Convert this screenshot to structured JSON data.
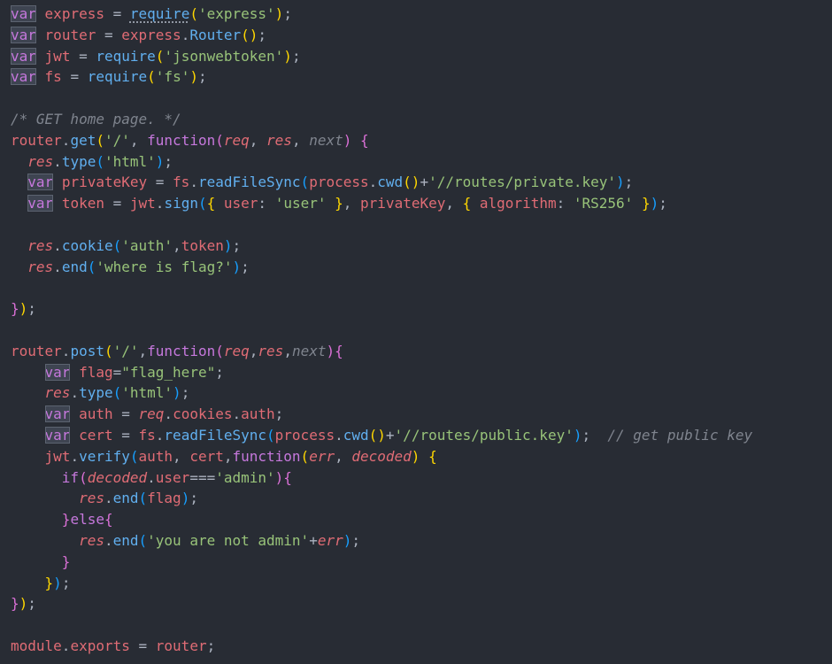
{
  "theme": {
    "background": "#282c34",
    "keyword": "#c678dd",
    "identifier": "#e06c75",
    "function": "#61afef",
    "string": "#98c379",
    "comment": "#7f848e",
    "bracket1": "#ffd700",
    "bracket2": "#da70d6",
    "bracket3": "#179fff"
  },
  "lines": [
    [
      [
        "var",
        "var"
      ],
      [
        "p",
        " "
      ],
      [
        "id",
        "express"
      ],
      [
        "p",
        " = "
      ],
      [
        "fn",
        "require",
        "squiggle"
      ],
      [
        "b1",
        "("
      ],
      [
        "str",
        "'express'"
      ],
      [
        "b1",
        ")"
      ],
      [
        "p",
        ";"
      ]
    ],
    [
      [
        "var",
        "var"
      ],
      [
        "p",
        " "
      ],
      [
        "id",
        "router"
      ],
      [
        "p",
        " = "
      ],
      [
        "id",
        "express"
      ],
      [
        "p",
        "."
      ],
      [
        "fn",
        "Router"
      ],
      [
        "b1",
        "()"
      ],
      [
        "p",
        ";"
      ]
    ],
    [
      [
        "var",
        "var"
      ],
      [
        "p",
        " "
      ],
      [
        "id",
        "jwt"
      ],
      [
        "p",
        " = "
      ],
      [
        "fn",
        "require"
      ],
      [
        "b1",
        "("
      ],
      [
        "str",
        "'jsonwebtoken'"
      ],
      [
        "b1",
        ")"
      ],
      [
        "p",
        ";"
      ]
    ],
    [
      [
        "var",
        "var"
      ],
      [
        "p",
        " "
      ],
      [
        "id",
        "fs"
      ],
      [
        "p",
        " = "
      ],
      [
        "fn",
        "require"
      ],
      [
        "b1",
        "("
      ],
      [
        "str",
        "'fs'"
      ],
      [
        "b1",
        ")"
      ],
      [
        "p",
        ";"
      ]
    ],
    [],
    [
      [
        "com",
        "/* GET home page. */"
      ]
    ],
    [
      [
        "id",
        "router"
      ],
      [
        "p",
        "."
      ],
      [
        "fn",
        "get"
      ],
      [
        "b1",
        "("
      ],
      [
        "str",
        "'/'"
      ],
      [
        "p",
        ", "
      ],
      [
        "kw",
        "function"
      ],
      [
        "b2",
        "("
      ],
      [
        "param",
        "req"
      ],
      [
        "p",
        ", "
      ],
      [
        "param",
        "res"
      ],
      [
        "p",
        ", "
      ],
      [
        "dim",
        "next"
      ],
      [
        "b2",
        ")"
      ],
      [
        "p",
        " "
      ],
      [
        "b2",
        "{"
      ]
    ],
    [
      [
        "p",
        "  "
      ],
      [
        "param",
        "res"
      ],
      [
        "p",
        "."
      ],
      [
        "fn",
        "type"
      ],
      [
        "b3",
        "("
      ],
      [
        "str",
        "'html'"
      ],
      [
        "b3",
        ")"
      ],
      [
        "p",
        ";"
      ]
    ],
    [
      [
        "p",
        "  "
      ],
      [
        "var",
        "var"
      ],
      [
        "p",
        " "
      ],
      [
        "id",
        "privateKey"
      ],
      [
        "p",
        " = "
      ],
      [
        "id",
        "fs"
      ],
      [
        "p",
        "."
      ],
      [
        "fn",
        "readFileSync"
      ],
      [
        "b3",
        "("
      ],
      [
        "id",
        "process"
      ],
      [
        "p",
        "."
      ],
      [
        "fn",
        "cwd"
      ],
      [
        "b1",
        "()"
      ],
      [
        "p",
        "+"
      ],
      [
        "str",
        "'//routes/private.key'"
      ],
      [
        "b3",
        ")"
      ],
      [
        "p",
        ";"
      ]
    ],
    [
      [
        "p",
        "  "
      ],
      [
        "var",
        "var"
      ],
      [
        "p",
        " "
      ],
      [
        "id",
        "token"
      ],
      [
        "p",
        " = "
      ],
      [
        "id",
        "jwt"
      ],
      [
        "p",
        "."
      ],
      [
        "fn",
        "sign"
      ],
      [
        "b3",
        "("
      ],
      [
        "b1",
        "{"
      ],
      [
        "p",
        " "
      ],
      [
        "prop",
        "user"
      ],
      [
        "p",
        ": "
      ],
      [
        "str",
        "'user'"
      ],
      [
        "p",
        " "
      ],
      [
        "b1",
        "}"
      ],
      [
        "p",
        ", "
      ],
      [
        "id",
        "privateKey"
      ],
      [
        "p",
        ", "
      ],
      [
        "b1",
        "{"
      ],
      [
        "p",
        " "
      ],
      [
        "prop",
        "algorithm"
      ],
      [
        "p",
        ": "
      ],
      [
        "str",
        "'RS256'"
      ],
      [
        "p",
        " "
      ],
      [
        "b1",
        "}"
      ],
      [
        "b3",
        ")"
      ],
      [
        "p",
        ";"
      ]
    ],
    [],
    [
      [
        "p",
        "  "
      ],
      [
        "param",
        "res"
      ],
      [
        "p",
        "."
      ],
      [
        "fn",
        "cookie"
      ],
      [
        "b3",
        "("
      ],
      [
        "str",
        "'auth'"
      ],
      [
        "p",
        ","
      ],
      [
        "id",
        "token"
      ],
      [
        "b3",
        ")"
      ],
      [
        "p",
        ";"
      ]
    ],
    [
      [
        "p",
        "  "
      ],
      [
        "param",
        "res"
      ],
      [
        "p",
        "."
      ],
      [
        "fn",
        "end"
      ],
      [
        "b3",
        "("
      ],
      [
        "str",
        "'where is flag?'"
      ],
      [
        "b3",
        ")"
      ],
      [
        "p",
        ";"
      ]
    ],
    [],
    [
      [
        "b2",
        "}"
      ],
      [
        "b1",
        ")"
      ],
      [
        "p",
        ";"
      ]
    ],
    [],
    [
      [
        "id",
        "router"
      ],
      [
        "p",
        "."
      ],
      [
        "fn",
        "post"
      ],
      [
        "b1",
        "("
      ],
      [
        "str",
        "'/'"
      ],
      [
        "p",
        ","
      ],
      [
        "kw",
        "function"
      ],
      [
        "b2",
        "("
      ],
      [
        "param",
        "req"
      ],
      [
        "p",
        ","
      ],
      [
        "param",
        "res"
      ],
      [
        "p",
        ","
      ],
      [
        "dim",
        "next"
      ],
      [
        "b2",
        ")"
      ],
      [
        "b2",
        "{"
      ]
    ],
    [
      [
        "p",
        "    "
      ],
      [
        "var",
        "var"
      ],
      [
        "p",
        " "
      ],
      [
        "id",
        "flag"
      ],
      [
        "p",
        "="
      ],
      [
        "str",
        "\"flag_here\""
      ],
      [
        "p",
        ";"
      ]
    ],
    [
      [
        "p",
        "    "
      ],
      [
        "param",
        "res"
      ],
      [
        "p",
        "."
      ],
      [
        "fn",
        "type"
      ],
      [
        "b3",
        "("
      ],
      [
        "str",
        "'html'"
      ],
      [
        "b3",
        ")"
      ],
      [
        "p",
        ";"
      ]
    ],
    [
      [
        "p",
        "    "
      ],
      [
        "var",
        "var"
      ],
      [
        "p",
        " "
      ],
      [
        "id",
        "auth"
      ],
      [
        "p",
        " = "
      ],
      [
        "param",
        "req"
      ],
      [
        "p",
        "."
      ],
      [
        "id",
        "cookies"
      ],
      [
        "p",
        "."
      ],
      [
        "id",
        "auth"
      ],
      [
        "p",
        ";"
      ]
    ],
    [
      [
        "p",
        "    "
      ],
      [
        "var",
        "var"
      ],
      [
        "p",
        " "
      ],
      [
        "id",
        "cert"
      ],
      [
        "p",
        " = "
      ],
      [
        "id",
        "fs"
      ],
      [
        "p",
        "."
      ],
      [
        "fn",
        "readFileSync"
      ],
      [
        "b3",
        "("
      ],
      [
        "id",
        "process"
      ],
      [
        "p",
        "."
      ],
      [
        "fn",
        "cwd"
      ],
      [
        "b1",
        "()"
      ],
      [
        "p",
        "+"
      ],
      [
        "str",
        "'//routes/public.key'"
      ],
      [
        "b3",
        ")"
      ],
      [
        "p",
        ";  "
      ],
      [
        "com",
        "// get public key"
      ]
    ],
    [
      [
        "p",
        "    "
      ],
      [
        "id",
        "jwt"
      ],
      [
        "p",
        "."
      ],
      [
        "fn",
        "verify"
      ],
      [
        "b3",
        "("
      ],
      [
        "id",
        "auth"
      ],
      [
        "p",
        ", "
      ],
      [
        "id",
        "cert"
      ],
      [
        "p",
        ","
      ],
      [
        "kw",
        "function"
      ],
      [
        "b1",
        "("
      ],
      [
        "param",
        "err"
      ],
      [
        "p",
        ", "
      ],
      [
        "param",
        "decoded"
      ],
      [
        "b1",
        ")"
      ],
      [
        "p",
        " "
      ],
      [
        "b1",
        "{"
      ]
    ],
    [
      [
        "p",
        "      "
      ],
      [
        "kw",
        "if"
      ],
      [
        "b2",
        "("
      ],
      [
        "param",
        "decoded"
      ],
      [
        "p",
        "."
      ],
      [
        "id",
        "user"
      ],
      [
        "p",
        "==="
      ],
      [
        "str",
        "'admin'"
      ],
      [
        "b2",
        ")"
      ],
      [
        "b2",
        "{"
      ]
    ],
    [
      [
        "p",
        "        "
      ],
      [
        "param",
        "res"
      ],
      [
        "p",
        "."
      ],
      [
        "fn",
        "end"
      ],
      [
        "b3",
        "("
      ],
      [
        "id",
        "flag"
      ],
      [
        "b3",
        ")"
      ],
      [
        "p",
        ";"
      ]
    ],
    [
      [
        "p",
        "      "
      ],
      [
        "b2",
        "}"
      ],
      [
        "kw",
        "else"
      ],
      [
        "b2",
        "{"
      ]
    ],
    [
      [
        "p",
        "        "
      ],
      [
        "param",
        "res"
      ],
      [
        "p",
        "."
      ],
      [
        "fn",
        "end"
      ],
      [
        "b3",
        "("
      ],
      [
        "str",
        "'you are not admin'"
      ],
      [
        "p",
        "+"
      ],
      [
        "param",
        "err"
      ],
      [
        "b3",
        ")"
      ],
      [
        "p",
        ";"
      ]
    ],
    [
      [
        "p",
        "      "
      ],
      [
        "b2",
        "}"
      ]
    ],
    [
      [
        "p",
        "    "
      ],
      [
        "b1",
        "}"
      ],
      [
        "b3",
        ")"
      ],
      [
        "p",
        ";"
      ]
    ],
    [
      [
        "b2",
        "}"
      ],
      [
        "b1",
        ")"
      ],
      [
        "p",
        ";"
      ]
    ],
    [],
    [
      [
        "id",
        "module"
      ],
      [
        "p",
        "."
      ],
      [
        "id",
        "exports"
      ],
      [
        "p",
        " = "
      ],
      [
        "id",
        "router"
      ],
      [
        "p",
        ";"
      ]
    ]
  ]
}
